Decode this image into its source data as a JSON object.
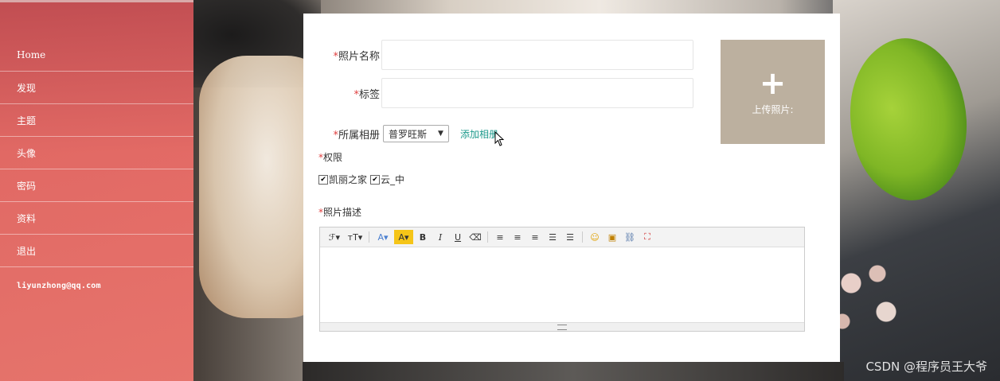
{
  "sidebar": {
    "items": [
      {
        "label": "Home"
      },
      {
        "label": "发现"
      },
      {
        "label": "主题"
      },
      {
        "label": "头像"
      },
      {
        "label": "密码"
      },
      {
        "label": "资料"
      },
      {
        "label": "退出"
      }
    ],
    "email": "liyunzhong@qq.com"
  },
  "form": {
    "required_mark": "*",
    "photo_name_label": "照片名称",
    "tag_label": "标签",
    "album_label": "所属相册",
    "album_selected": "普罗旺斯",
    "add_album_link": "添加相册",
    "permission_label": "权限",
    "permission_options": [
      {
        "label": "凯丽之家",
        "checked": true
      },
      {
        "label": "云_中",
        "checked": true
      }
    ],
    "description_label": "照片描述"
  },
  "upload": {
    "plus": "+",
    "label": "上传照片:"
  },
  "editor": {
    "tools": [
      {
        "name": "font-family-icon",
        "glyph": "ℱ▾"
      },
      {
        "name": "font-size-icon",
        "glyph": "тT▾"
      },
      {
        "name": "font-color-icon",
        "glyph": "A▾"
      },
      {
        "name": "highlight-color-icon",
        "glyph": "A▾"
      },
      {
        "name": "bold-icon",
        "glyph": "B"
      },
      {
        "name": "italic-icon",
        "glyph": "I"
      },
      {
        "name": "underline-icon",
        "glyph": "U"
      },
      {
        "name": "eraser-icon",
        "glyph": "⌫"
      },
      {
        "name": "align-left-icon",
        "glyph": "≡"
      },
      {
        "name": "align-center-icon",
        "glyph": "≡"
      },
      {
        "name": "align-right-icon",
        "glyph": "≡"
      },
      {
        "name": "ordered-list-icon",
        "glyph": "☰"
      },
      {
        "name": "unordered-list-icon",
        "glyph": "☰"
      },
      {
        "name": "emoticon-icon",
        "glyph": "☺"
      },
      {
        "name": "image-icon",
        "glyph": "▣"
      },
      {
        "name": "link-icon",
        "glyph": "⛓"
      },
      {
        "name": "fullscreen-icon",
        "glyph": "⛶"
      }
    ]
  },
  "watermark": "CSDN @程序员王大爷",
  "colors": {
    "sidebar": "#f07a73",
    "accent_link": "#1e9a8c",
    "upload_bg": "#bcb09f",
    "required": "#e04040"
  }
}
